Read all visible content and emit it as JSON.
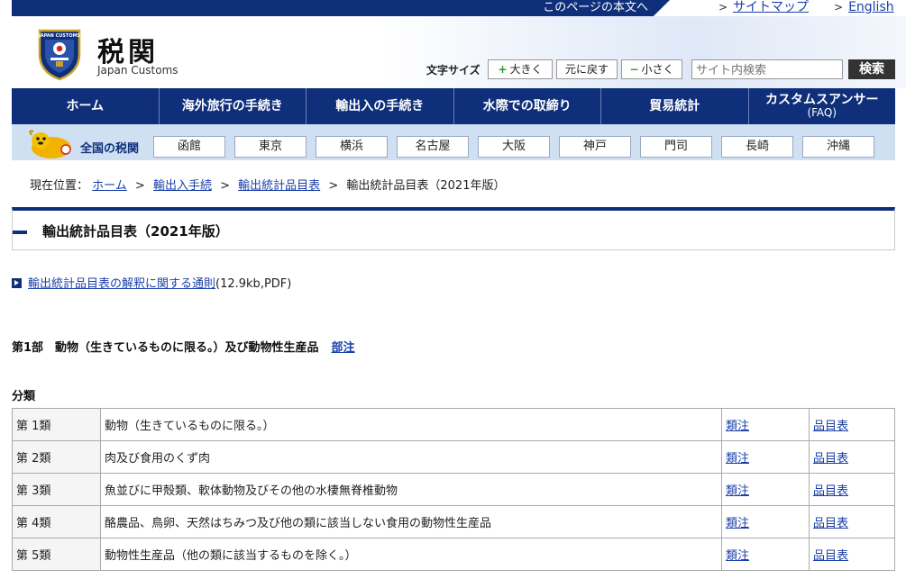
{
  "topbar": {
    "skip_link": "このページの本文へ",
    "sitemap": "サイトマップ",
    "english": "English"
  },
  "header": {
    "title": "税関",
    "subtitle": "Japan Customs",
    "logo_text": "JAPAN CUSTOMS",
    "font_size_label": "文字サイズ",
    "font_larger": "大きく",
    "font_reset": "元に戻す",
    "font_smaller": "小さく",
    "search_placeholder": "サイト内検索",
    "search_button": "検索"
  },
  "main_nav": [
    {
      "label": "ホーム"
    },
    {
      "label": "海外旅行の手続き"
    },
    {
      "label": "輸出入の手続き"
    },
    {
      "label": "水際での取締り"
    },
    {
      "label": "貿易統計"
    },
    {
      "label": "カスタムスアンサー",
      "sub": "(FAQ)"
    }
  ],
  "sub_nav": {
    "label": "全国の税関",
    "cities": [
      "函館",
      "東京",
      "横浜",
      "名古屋",
      "大阪",
      "神戸",
      "門司",
      "長崎",
      "沖縄"
    ]
  },
  "breadcrumb": {
    "prefix": "現在位置：",
    "items": [
      "ホーム",
      "輸出入手続",
      "輸出統計品目表"
    ],
    "current": "輸出統計品目表（2021年版）"
  },
  "page": {
    "title": "輸出統計品目表（2021年版）",
    "doc_link": "輸出統計品目表の解釈に関する通則",
    "doc_meta": "(12.9kb,PDF)",
    "section_title": "第1部　動物（生きているものに限る。）及び動物性生産品",
    "section_note": "部注",
    "classification_label": "分類"
  },
  "chapters": [
    {
      "num": "第 1類",
      "desc": "動物（生きているものに限る。）",
      "note": "類注",
      "list": "品目表"
    },
    {
      "num": "第 2類",
      "desc": "肉及び食用のくず肉",
      "note": "類注",
      "list": "品目表"
    },
    {
      "num": "第 3類",
      "desc": "魚並びに甲殻類、軟体動物及びその他の水棲無脊椎動物",
      "note": "類注",
      "list": "品目表"
    },
    {
      "num": "第 4類",
      "desc": "酪農品、鳥卵、天然はちみつ及び他の類に該当しない食用の動物性生産品",
      "note": "類注",
      "list": "品目表"
    },
    {
      "num": "第 5類",
      "desc": "動物性生産品（他の類に該当するものを除く。）",
      "note": "類注",
      "list": "品目表"
    }
  ]
}
